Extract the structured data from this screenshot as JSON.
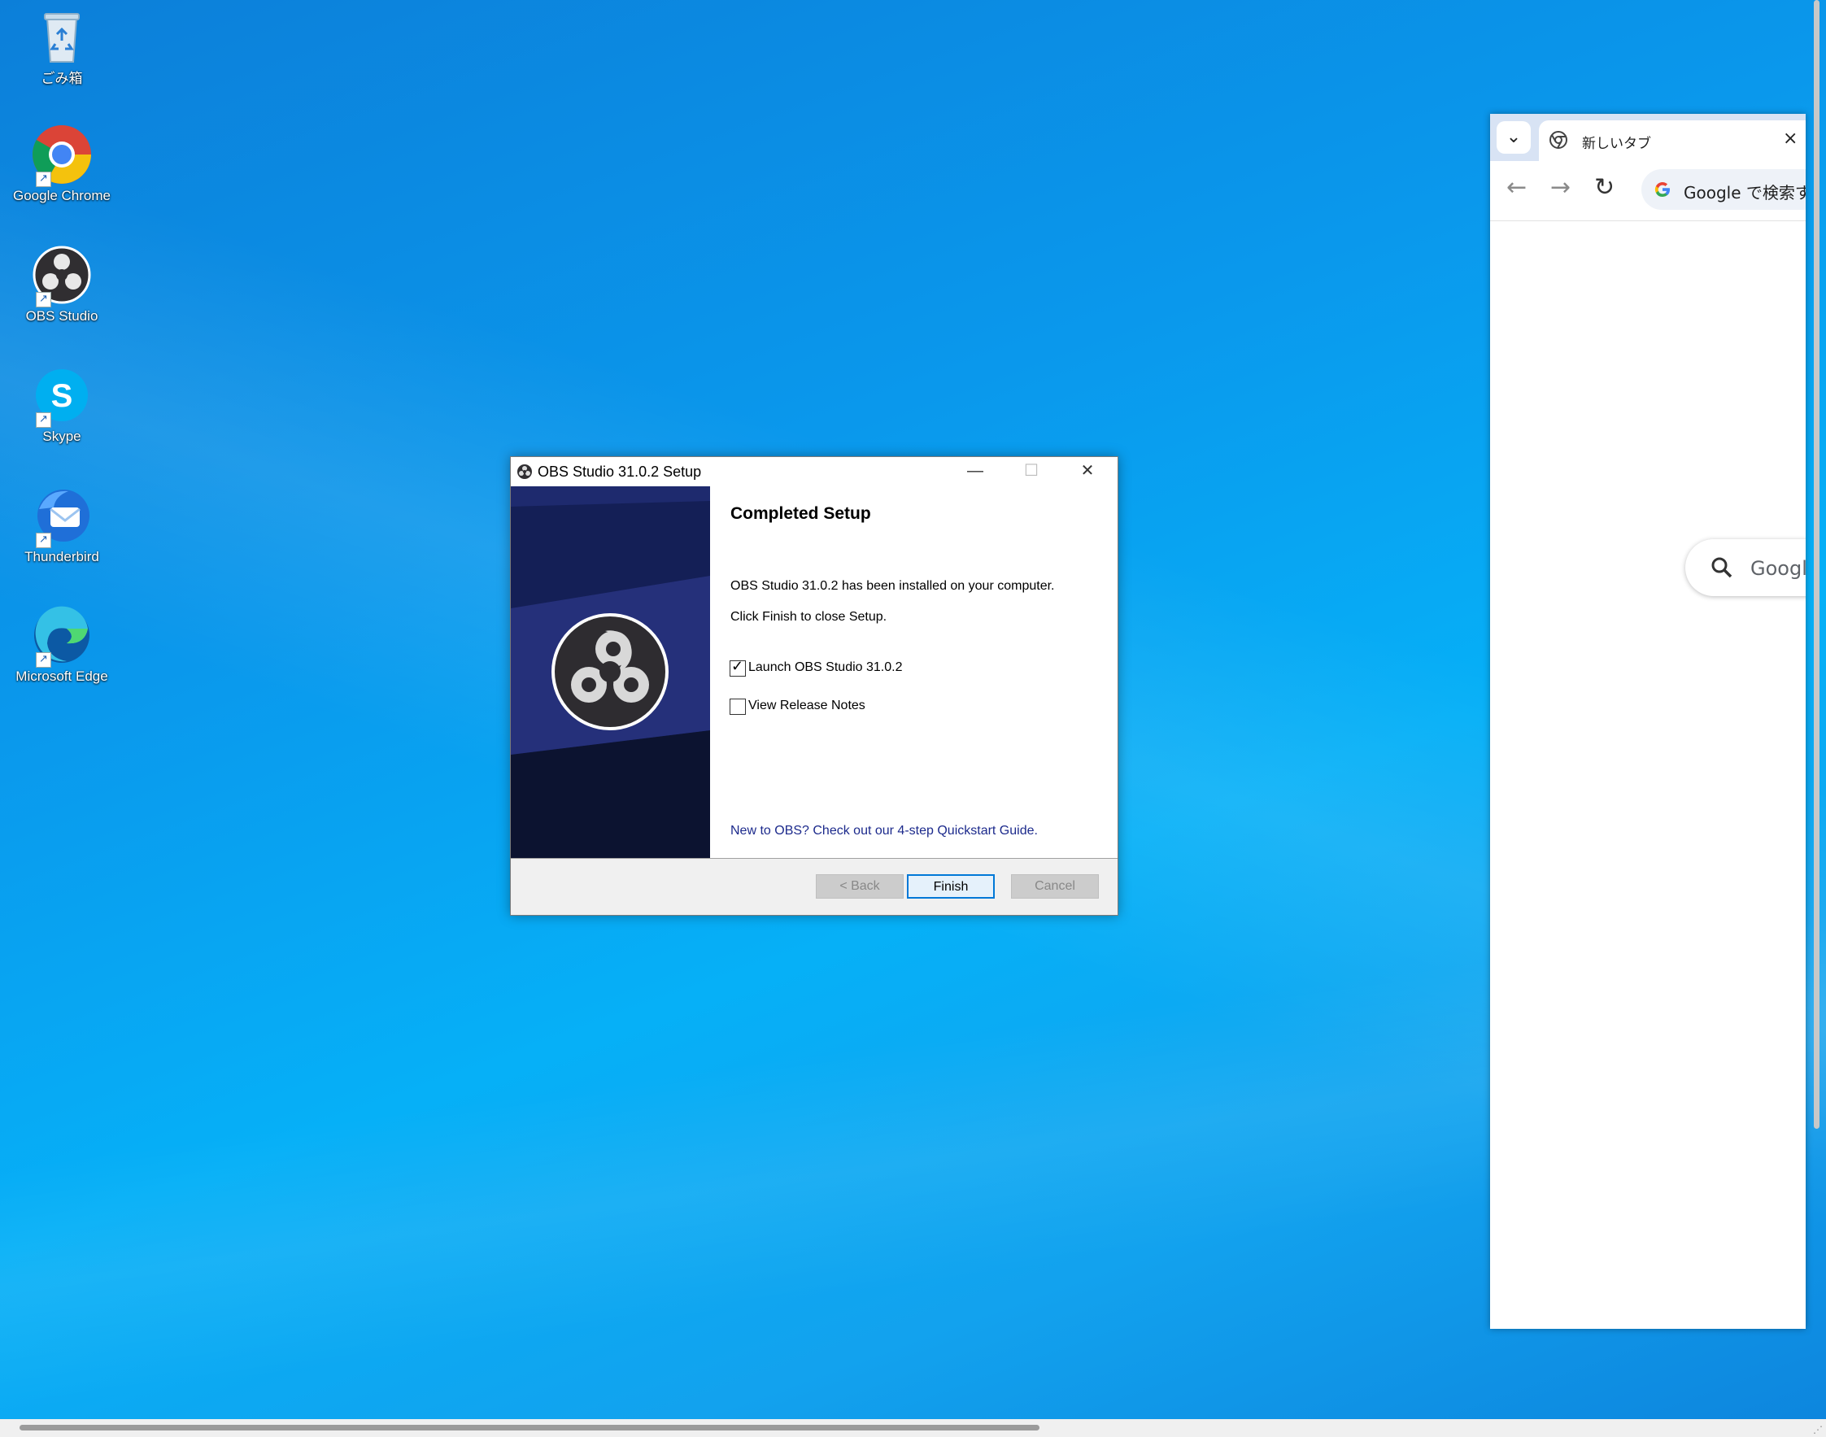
{
  "desktop": {
    "icons": [
      {
        "label": "ごみ箱"
      },
      {
        "label": "Google Chrome"
      },
      {
        "label": "OBS Studio"
      },
      {
        "label": "Skype"
      },
      {
        "label": "Thunderbird"
      },
      {
        "label": "Microsoft Edge"
      }
    ]
  },
  "browser": {
    "tab_title": "新しいタブ",
    "omnibox_text": "Google で検索す",
    "search_text": "Googl"
  },
  "dialog": {
    "title": "OBS Studio 31.0.2 Setup",
    "heading": "Completed Setup",
    "line1": "OBS Studio 31.0.2 has been installed on your computer.",
    "line2": "Click Finish to close Setup.",
    "checkbox_launch": {
      "label": "Launch OBS Studio 31.0.2",
      "checked": true
    },
    "checkbox_notes": {
      "label": "View Release Notes",
      "checked": false
    },
    "link": "New to OBS? Check out our 4-step Quickstart Guide.",
    "buttons": {
      "back": "< Back",
      "finish": "Finish",
      "cancel": "Cancel"
    }
  },
  "colors": {
    "accent": "#0078d7",
    "link": "#1c2a8c",
    "desktop": "#0a98ec"
  }
}
